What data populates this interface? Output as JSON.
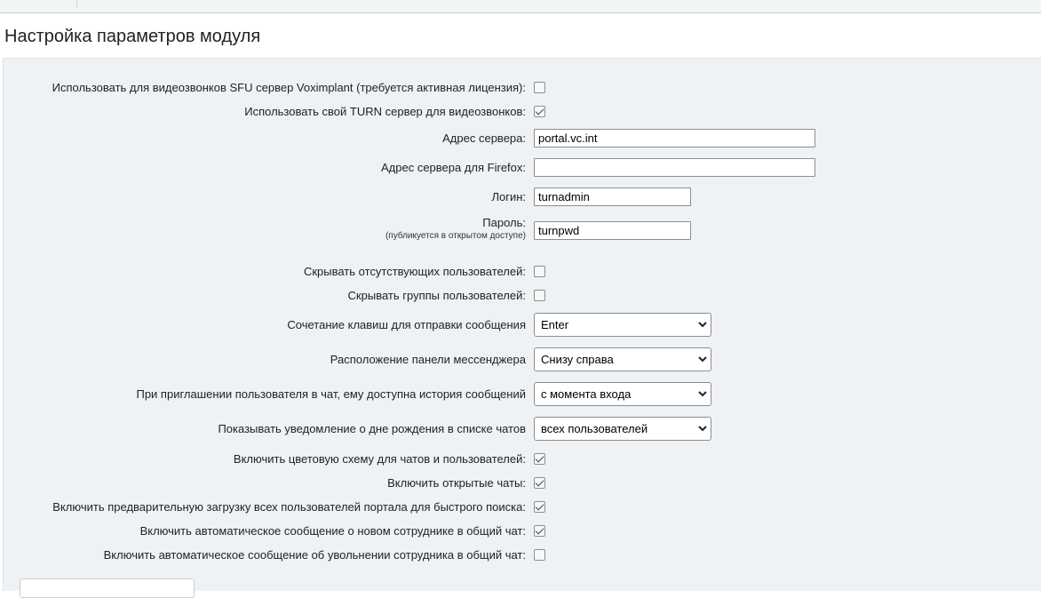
{
  "page": {
    "title": "Настройка параметров модуля"
  },
  "settings": {
    "sfu": {
      "label": "Использовать для видеозвонков SFU сервер Voximplant (требуется активная лицензия):",
      "checked": false
    },
    "turn": {
      "label": "Использовать свой TURN сервер для видеозвонков:",
      "checked": true
    },
    "server_address": {
      "label": "Адрес сервера:",
      "value": "portal.vc.int"
    },
    "server_address_firefox": {
      "label": "Адрес сервера для Firefox:",
      "value": ""
    },
    "login": {
      "label": "Логин:",
      "value": "turnadmin"
    },
    "password": {
      "label": "Пароль:",
      "sublabel": "(публикуется в открытом доступе)",
      "value": "turnpwd"
    },
    "hide_absent": {
      "label": "Скрывать отсутствующих пользователей:",
      "checked": false
    },
    "hide_groups": {
      "label": "Скрывать группы пользователей:",
      "checked": false
    },
    "send_hotkey": {
      "label": "Сочетание клавиш для отправки сообщения",
      "selected": "Enter"
    },
    "panel_position": {
      "label": "Расположение панели мессенджера",
      "selected": "Снизу справа"
    },
    "invite_history": {
      "label": "При приглашении пользователя в чат, ему доступна история сообщений",
      "selected": "с момента входа"
    },
    "birthday_notify": {
      "label": "Показывать уведомление о дне рождения в списке чатов",
      "selected": "всех пользователей"
    },
    "color_scheme": {
      "label": "Включить цветовую схему для чатов и пользователей:",
      "checked": true
    },
    "open_chats": {
      "label": "Включить открытые чаты:",
      "checked": true
    },
    "preload_users": {
      "label": "Включить предварительную загрузку всех пользователей портала для быстрого поиска:",
      "checked": true
    },
    "new_employee_msg": {
      "label": "Включить автоматическое сообщение о новом сотруднике в общий чат:",
      "checked": true
    },
    "dismissal_msg": {
      "label": "Включить автоматическое сообщение об увольнении сотрудника в общий чат:",
      "checked": false
    }
  },
  "icons": {
    "select_arrow": "chevron-down-icon",
    "checkbox": "checkmark-icon"
  }
}
